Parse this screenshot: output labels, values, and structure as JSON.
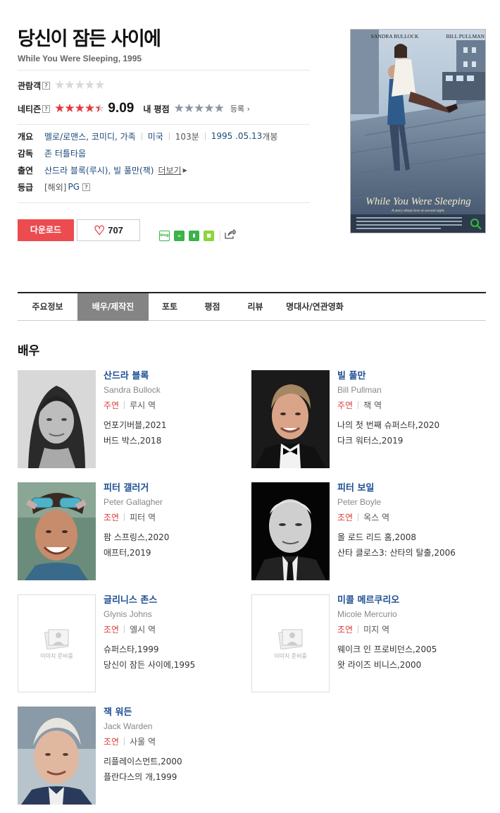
{
  "movie": {
    "title": "당신이 잠든 사이에",
    "subtitle": "While You Were Sleeping, 1995"
  },
  "ratings": {
    "audience_label": "관람객",
    "netizen_label": "네티즌",
    "netizen_score": "9.09",
    "netizen_stars": 4.5,
    "my_rating_label": "내 평점",
    "register_label": "등록"
  },
  "info": {
    "overview_label": "개요",
    "genres": "멜로/로맨스, 코미디, 가족",
    "country": "미국",
    "runtime": "103분",
    "release": "1995 .05.13",
    "release_suffix": "개봉",
    "director_label": "감독",
    "director": "존 터틀타웁",
    "cast_label": "출연",
    "cast_text": "산드라 블록(루시), 빌 풀만(잭)",
    "more_label": "더보기",
    "grade_label": "등급",
    "grade_region": "[해외]",
    "grade": "PG"
  },
  "actions": {
    "download_label": "다운로드",
    "like_count": "707"
  },
  "share": {
    "blog_label": "blog"
  },
  "poster": {
    "actor1": "SANDRA BULLOCK",
    "actor2": "BILL PULLMAN",
    "title": "While You Were Sleeping",
    "tagline": "A story about love at second sight."
  },
  "tabs": [
    {
      "label": "주요정보"
    },
    {
      "label": "배우/제작진"
    },
    {
      "label": "포토"
    },
    {
      "label": "평점"
    },
    {
      "label": "리뷰"
    },
    {
      "label": "명대사/연관영화"
    }
  ],
  "section_title": "배우",
  "placeholder_text": "이미지 준비중",
  "cast": [
    {
      "name": "산드라 블록",
      "eng": "Sandra Bullock",
      "role_type": "주연",
      "role": "루시 역",
      "films": [
        "언포기버블,2021",
        "버드 박스,2018"
      ]
    },
    {
      "name": "빌 풀만",
      "eng": "Bill Pullman",
      "role_type": "주연",
      "role": "잭 역",
      "films": [
        "나의 첫 번째 슈퍼스타,2020",
        "다크 워터스,2019"
      ]
    },
    {
      "name": "피터 갤러거",
      "eng": "Peter Gallagher",
      "role_type": "조연",
      "role": "피터 역",
      "films": [
        "팜 스프링스,2020",
        "애프터,2019"
      ]
    },
    {
      "name": "피터 보일",
      "eng": "Peter Boyle",
      "role_type": "조연",
      "role": "옥스 역",
      "films": [
        "올 로드 리드 홈,2008",
        "산타 클로스3: 산타의 탈출,2006"
      ]
    },
    {
      "name": "글리니스 존스",
      "eng": "Glynis Johns",
      "role_type": "조연",
      "role": "엘시 역",
      "films": [
        "슈퍼스타,1999",
        "당신이 잠든 사이에,1995"
      ]
    },
    {
      "name": "미콜 메르쿠리오",
      "eng": "Micole Mercurio",
      "role_type": "조연",
      "role": "미지 역",
      "films": [
        "웨이크 인 프로비던스,2005",
        "왓 라이즈 비니스,2000"
      ]
    },
    {
      "name": "잭 워든",
      "eng": "Jack Warden",
      "role_type": "조연",
      "role": "사울 역",
      "films": [
        "리플레이스먼트,2000",
        "플란다스의 개,1999"
      ]
    }
  ]
}
